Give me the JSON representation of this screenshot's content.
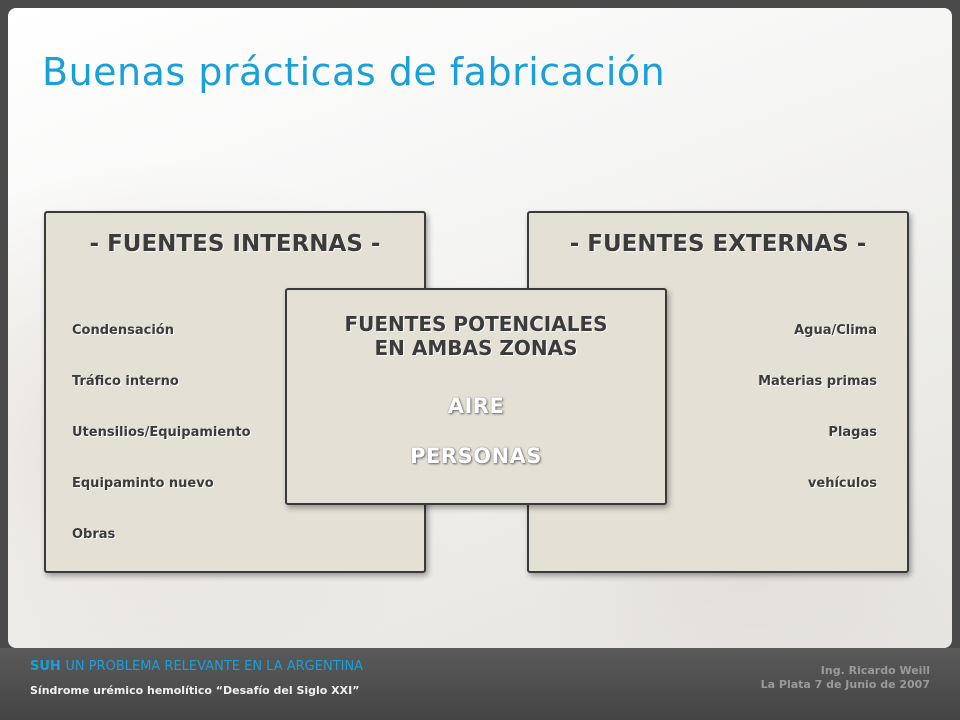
{
  "slide": {
    "title": "Buenas prácticas de fabricación"
  },
  "internas": {
    "heading": "- FUENTES INTERNAS -",
    "items": [
      "Condensación",
      "Tráfico interno",
      "Utensilios/Equipamiento",
      "Equipaminto nuevo",
      "Obras"
    ]
  },
  "externas": {
    "heading": "- FUENTES EXTERNAS -",
    "items": [
      "Agua/Clima",
      "Materias primas",
      "Plagas",
      "vehículos"
    ]
  },
  "ambas": {
    "heading_line1": "FUENTES POTENCIALES",
    "heading_line2": "EN AMBAS ZONAS",
    "items": [
      "AIRE",
      "PERSONAS"
    ]
  },
  "footer": {
    "brand": "SUH",
    "headline": "UN PROBLEMA RELEVANTE EN LA ARGENTINA",
    "subtitle": "Síndrome urémico hemolítico “Desafío del Siglo XXI”",
    "author": "Ing. Ricardo Weill",
    "place_date": "La Plata 7 de Junio de 2007"
  },
  "colors": {
    "title": "#1aa0d8",
    "box_fill": "#e4e0d6",
    "box_border": "#3a3a3a",
    "footer_bg": "#4a4a4a"
  }
}
